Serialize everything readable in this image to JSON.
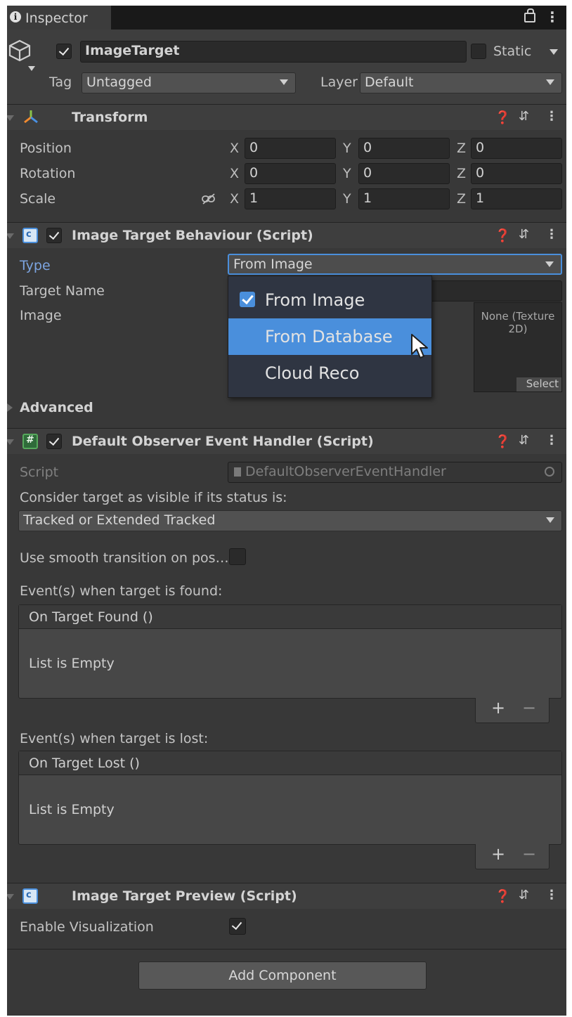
{
  "window": {
    "tab_label": "Inspector"
  },
  "gameobject": {
    "name": "ImageTarget",
    "active": true,
    "static_label": "Static",
    "static": false,
    "tag_label": "Tag",
    "tag_value": "Untagged",
    "layer_label": "Layer",
    "layer_value": "Default"
  },
  "transform": {
    "title": "Transform",
    "rows": [
      {
        "label": "Position",
        "x": "0",
        "y": "0",
        "z": "0"
      },
      {
        "label": "Rotation",
        "x": "0",
        "y": "0",
        "z": "0"
      },
      {
        "label": "Scale",
        "x": "1",
        "y": "1",
        "z": "1"
      }
    ],
    "axis_labels": {
      "x": "X",
      "y": "Y",
      "z": "Z"
    }
  },
  "image_target_behaviour": {
    "title": "Image Target Behaviour (Script)",
    "enabled": true,
    "type_label": "Type",
    "type_value": "From Image",
    "target_name_label": "Target Name",
    "image_label": "Image",
    "image_value": "None (Texture 2D)",
    "select_label": "Select",
    "advanced_label": "Advanced",
    "dropdown_options": [
      {
        "label": "From Image",
        "checked": true,
        "highlighted": false
      },
      {
        "label": "From Database",
        "checked": false,
        "highlighted": true
      },
      {
        "label": "Cloud Reco",
        "checked": false,
        "highlighted": false
      }
    ]
  },
  "observer_handler": {
    "title": "Default Observer Event Handler (Script)",
    "enabled": true,
    "script_label": "Script",
    "script_value": "DefaultObserverEventHandler",
    "consider_label": "Consider target as visible if its status is:",
    "status_value": "Tracked or Extended Tracked",
    "smooth_label": "Use smooth transition on pos…",
    "smooth_checked": false,
    "found_label": "Event(s) when target is found:",
    "found_event": "On Target Found ()",
    "found_empty": "List is Empty",
    "lost_label": "Event(s) when target is lost:",
    "lost_event": "On Target Lost ()",
    "lost_empty": "List is Empty",
    "plus": "+",
    "minus": "−"
  },
  "image_target_preview": {
    "title": "Image Target Preview (Script)",
    "visualization_label": "Enable Visualization",
    "visualization_enabled": true
  },
  "add_component_label": "Add Component",
  "colors": {
    "panel_bg": "#383838",
    "header_bg": "#3e3e3e",
    "field_bg": "#2a2a2a",
    "accent_blue": "#4a8fdc",
    "label_blue": "#7ca4e0"
  }
}
